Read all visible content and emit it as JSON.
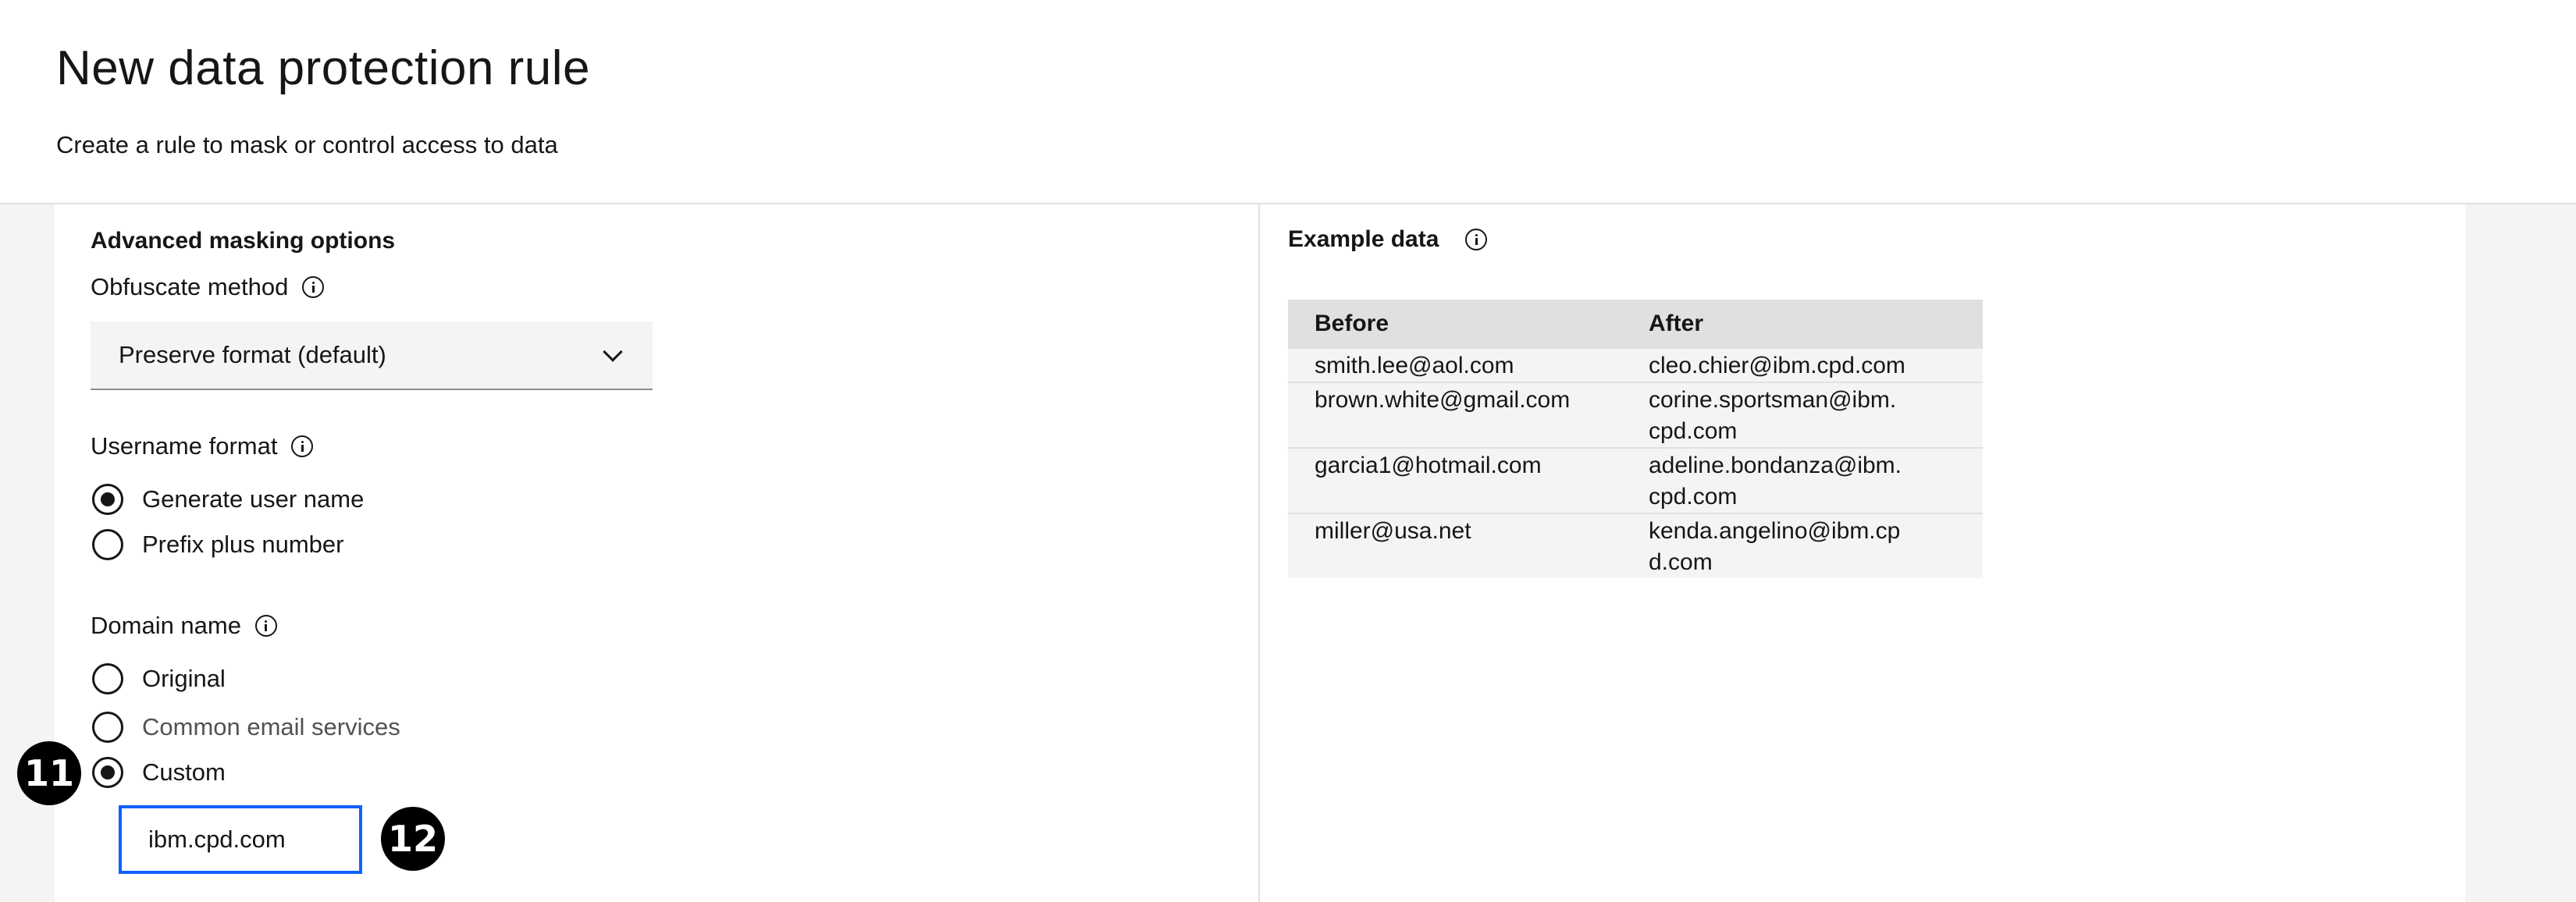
{
  "header": {
    "title": "New data protection rule",
    "subtitle": "Create a rule to mask or control access to data"
  },
  "masking": {
    "section_title": "Advanced masking options",
    "obfuscate_label": "Obfuscate method",
    "obfuscate_value": "Preserve format (default)",
    "username_label": "Username format",
    "username_options": [
      {
        "label": "Generate user name",
        "checked": true
      },
      {
        "label": "Prefix plus number",
        "checked": false
      }
    ],
    "domain_label": "Domain name",
    "domain_options": [
      {
        "label": "Original",
        "checked": false
      },
      {
        "label": "Common email services",
        "checked": false,
        "muted": true
      },
      {
        "label": "Custom",
        "checked": true
      }
    ],
    "custom_domain_value": "ibm.cpd.com"
  },
  "badges": {
    "first": "11",
    "second": "12"
  },
  "example": {
    "title": "Example data",
    "headers": [
      "Before",
      "After"
    ],
    "rows": [
      {
        "before": "smith.lee@aol.com",
        "after": "cleo.chier@ibm.cpd.com"
      },
      {
        "before": "brown.white@gmail.com",
        "after": "corine.sportsman@ibm.\ncpd.com"
      },
      {
        "before": "garcia1@hotmail.com",
        "after": "adeline.bondanza@ibm.\ncpd.com"
      },
      {
        "before": "miller@usa.net",
        "after": "kenda.angelino@ibm.cp\nd.com"
      }
    ]
  },
  "colors": {
    "focus": "#0f62fe",
    "field_bg": "#f4f4f4",
    "header_bg": "#e0e0e0"
  }
}
